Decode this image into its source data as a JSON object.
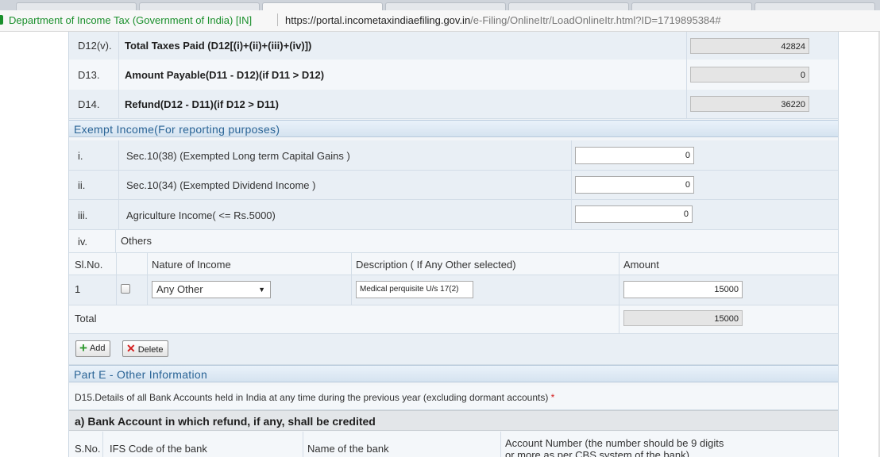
{
  "browser": {
    "ev_name": "Department of Income Tax (Government of India) [IN]",
    "url_host": "https://portal.incometaxindiaefiling.gov.in",
    "url_path": "/e-Filing/OnlineItr/LoadOnlineItr.html?ID=1719895384#",
    "colors": {
      "ev_green": "#1a8f2c"
    }
  },
  "taxes": [
    {
      "code": "D12(v).",
      "label": "Total Taxes Paid (D12[(i)+(ii)+(iii)+(iv)])",
      "value": "42824"
    },
    {
      "code": "D13.",
      "label": "Amount Payable(D11 - D12)(if D11 > D12)",
      "value": "0"
    },
    {
      "code": "D14.",
      "label": "Refund(D12 - D11)(if D12 > D11)",
      "value": "36220"
    }
  ],
  "exempt": {
    "title": "Exempt Income(For reporting purposes)",
    "rows": [
      {
        "code": "i.",
        "label": "Sec.10(38) (Exempted Long term Capital Gains )",
        "value": "0"
      },
      {
        "code": "ii.",
        "label": "Sec.10(34) (Exempted Dividend Income )",
        "value": "0"
      },
      {
        "code": "iii.",
        "label": "Agriculture Income( <= Rs.5000)",
        "value": "0"
      }
    ],
    "others": {
      "code": "iv.",
      "label": "Others",
      "columns": [
        "Sl.No.",
        "Nature of Income",
        "Description ( If Any Other selected)",
        "Amount"
      ],
      "rows": [
        {
          "sl": "1",
          "checked": false,
          "nature": "Any Other",
          "description": "Medical perquisite U/s 17(2)",
          "amount": "15000"
        }
      ],
      "total_label": "Total",
      "total_value": "15000"
    },
    "buttons": {
      "add": "Add",
      "delete": "Delete"
    }
  },
  "part_e": {
    "title": "Part E - Other Information",
    "d15": "D15.Details of all Bank Accounts held in India at any time during the previous year (excluding dormant accounts)",
    "required_mark": "*",
    "subsection": "a) Bank Account in which refund, if any, shall be credited",
    "columns": {
      "sno": "S.No.",
      "ifs": "IFS Code of the bank",
      "name": "Name of the bank",
      "account_line1": "Account Number (the number should be 9 digits",
      "account_line2": "or more as per CBS system of the bank)"
    }
  },
  "colors": {
    "section_text": "#2a6496",
    "required": "#d42020",
    "add_icon": "#2f9a2f",
    "delete_icon": "#d42020"
  }
}
